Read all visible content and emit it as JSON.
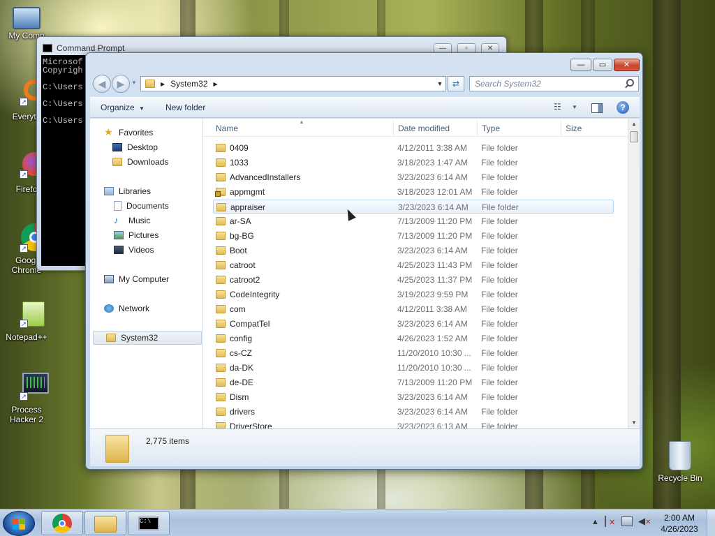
{
  "desktop": {
    "icons": [
      {
        "label": "My Comp",
        "icon": "computer-icon"
      },
      {
        "label": "Everyth",
        "icon": "everything-search-icon"
      },
      {
        "label": "Firefo",
        "icon": "firefox-icon"
      },
      {
        "label": "Googl Chrome",
        "icon": "chrome-icon"
      },
      {
        "label": "Notepad++",
        "icon": "notepad-plus-plus-icon"
      },
      {
        "label": "Process Hacker 2",
        "icon": "process-hacker-icon"
      },
      {
        "label": "Recycle Bin",
        "icon": "recycle-bin-icon"
      }
    ]
  },
  "cmd": {
    "title": "Command Prompt",
    "console_text": "Microsof\nCopyrigh\n\nC:\\Users\n\nC:\\Users\n\nC:\\Users"
  },
  "explorer": {
    "address": {
      "crumb": "System32"
    },
    "search_placeholder": "Search System32",
    "toolbar": {
      "organize": "Organize",
      "new_folder": "New folder"
    },
    "nav": {
      "favorites": "Favorites",
      "desktop": "Desktop",
      "downloads": "Downloads",
      "libraries": "Libraries",
      "documents": "Documents",
      "music": "Music",
      "pictures": "Pictures",
      "videos": "Videos",
      "my_computer": "My Computer",
      "network": "Network",
      "system32": "System32"
    },
    "columns": {
      "name": "Name",
      "date": "Date modified",
      "type": "Type",
      "size": "Size"
    },
    "files": [
      {
        "name": "0409",
        "date": "4/12/2011 3:38 AM",
        "type": "File folder"
      },
      {
        "name": "1033",
        "date": "3/18/2023 1:47 AM",
        "type": "File folder"
      },
      {
        "name": "AdvancedInstallers",
        "date": "3/23/2023 6:14 AM",
        "type": "File folder"
      },
      {
        "name": "appmgmt",
        "date": "3/18/2023 12:01 AM",
        "type": "File folder"
      },
      {
        "name": "appraiser",
        "date": "3/23/2023 6:14 AM",
        "type": "File folder"
      },
      {
        "name": "ar-SA",
        "date": "7/13/2009 11:20 PM",
        "type": "File folder"
      },
      {
        "name": "bg-BG",
        "date": "7/13/2009 11:20 PM",
        "type": "File folder"
      },
      {
        "name": "Boot",
        "date": "3/23/2023 6:14 AM",
        "type": "File folder"
      },
      {
        "name": "catroot",
        "date": "4/25/2023 11:43 PM",
        "type": "File folder"
      },
      {
        "name": "catroot2",
        "date": "4/25/2023 11:37 PM",
        "type": "File folder"
      },
      {
        "name": "CodeIntegrity",
        "date": "3/19/2023 9:59 PM",
        "type": "File folder"
      },
      {
        "name": "com",
        "date": "4/12/2011 3:38 AM",
        "type": "File folder"
      },
      {
        "name": "CompatTel",
        "date": "3/23/2023 6:14 AM",
        "type": "File folder"
      },
      {
        "name": "config",
        "date": "4/26/2023 1:52 AM",
        "type": "File folder"
      },
      {
        "name": "cs-CZ",
        "date": "11/20/2010 10:30 ...",
        "type": "File folder"
      },
      {
        "name": "da-DK",
        "date": "11/20/2010 10:30 ...",
        "type": "File folder"
      },
      {
        "name": "de-DE",
        "date": "7/13/2009 11:20 PM",
        "type": "File folder"
      },
      {
        "name": "Dism",
        "date": "3/23/2023 6:14 AM",
        "type": "File folder"
      },
      {
        "name": "drivers",
        "date": "3/23/2023 6:14 AM",
        "type": "File folder"
      },
      {
        "name": "DriverStore",
        "date": "3/23/2023 6:13 AM",
        "type": "File folder"
      }
    ],
    "item_count": "2,775 items"
  },
  "taskbar": {
    "time": "2:00 AM",
    "date": "4/26/2023"
  }
}
